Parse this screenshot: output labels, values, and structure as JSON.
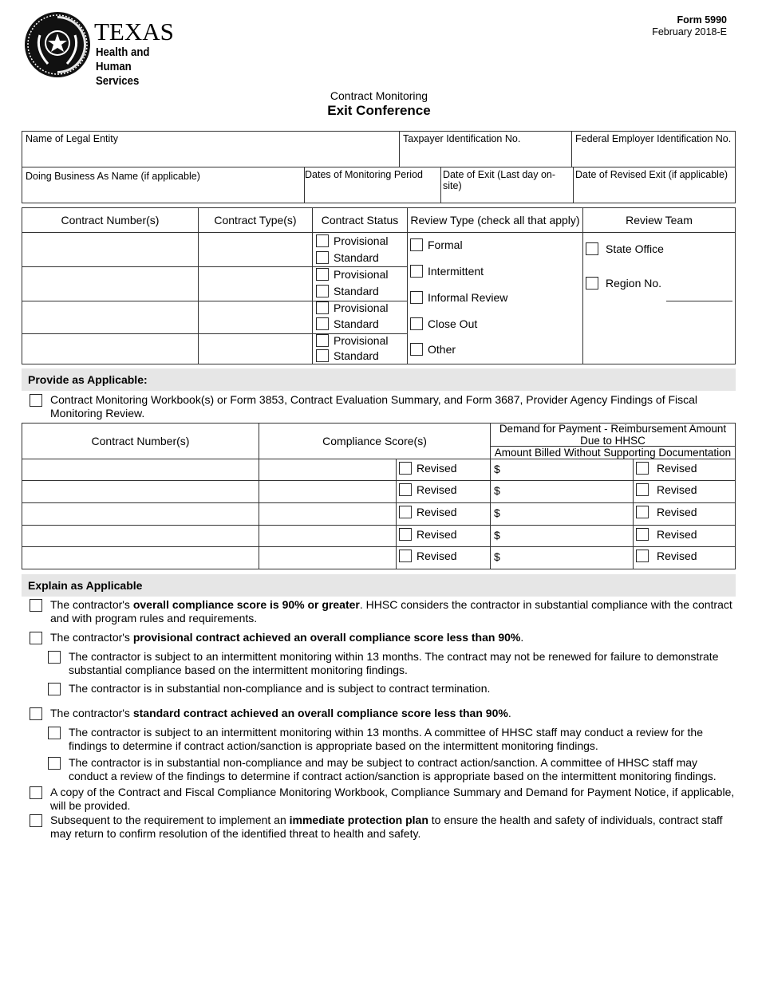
{
  "header": {
    "logo": {
      "icon": "texas-star-seal-icon",
      "line1": "TEXAS",
      "line2": "Health and Human",
      "line3": "Services"
    },
    "form_number": "Form 5990",
    "form_date": "February 2018-E",
    "subtitle": "Contract Monitoring",
    "title": "Exit Conference"
  },
  "entity_info": {
    "legal_entity_label": "Name of Legal Entity",
    "taxpayer_id_label": "Taxpayer Identification No.",
    "fein_label": "Federal Employer Identification No.",
    "dba_label": "Doing Business As Name (if applicable)",
    "monitoring_period_label": "Dates of Monitoring Period",
    "exit_date_label": "Date of Exit (Last day on-site)",
    "revised_exit_label": "Date of Revised Exit (if applicable)"
  },
  "contract_table": {
    "headers": [
      "Contract Number(s)",
      "Contract Type(s)",
      "Contract Status",
      "Review Type (check all that apply)",
      "Review Team"
    ],
    "status_options": [
      "Provisional",
      "Standard"
    ],
    "rows": 4,
    "review_types": [
      "Formal",
      "Intermittent",
      "Informal Review",
      "Close Out",
      "Other"
    ],
    "review_team": [
      "State Office",
      "Region No."
    ]
  },
  "provide": {
    "heading": "Provide as Applicable:",
    "item": "Contract Monitoring Workbook(s) or Form 3853, Contract Evaluation Summary, and Form 3687, Provider Agency Findings of Fiscal Monitoring Review."
  },
  "compliance_table": {
    "headers": {
      "contract_numbers": "Contract Number(s)",
      "compliance_scores": "Compliance Score(s)",
      "demand_payment": "Demand for Payment - Reimbursement Amount Due to HHSC",
      "amount_billed": "Amount Billed Without Supporting Documentation"
    },
    "revised_label": "Revised",
    "currency": "$",
    "rows": 5
  },
  "explain": {
    "heading": "Explain as Applicable",
    "items": [
      {
        "pre": "The contractor's ",
        "bold": "overall compliance score is 90% or greater",
        "post": ". HHSC considers the contractor in substantial compliance with the contract and with program rules and requirements."
      },
      {
        "pre": "The contractor's ",
        "bold": "provisional contract achieved an overall compliance score less than 90%",
        "post": "."
      },
      {
        "pre": "The contractor is subject to an intermittent monitoring within 13 months. The contract may not be renewed for failure to demonstrate substantial compliance based on the intermittent monitoring findings.",
        "bold": "",
        "post": ""
      },
      {
        "pre": "The contractor is in substantial non-compliance and is subject to contract termination.",
        "bold": "",
        "post": ""
      },
      {
        "pre": "The contractor's ",
        "bold": "standard contract achieved an overall compliance score less than 90%",
        "post": "."
      },
      {
        "pre": "The contractor is subject to an intermittent monitoring within 13 months. A committee of HHSC staff may conduct a review for the findings to determine if contract action/sanction is appropriate based on the intermittent monitoring findings.",
        "bold": "",
        "post": ""
      },
      {
        "pre": "The contractor is in substantial non-compliance and may be subject to contract action/sanction. A committee of HHSC staff may conduct a review of the findings to determine if contract action/sanction is appropriate based on the intermittent monitoring findings.",
        "bold": "",
        "post": ""
      },
      {
        "pre": "A copy of the Contract and Fiscal Compliance Monitoring Workbook, Compliance Summary and Demand for Payment Notice, if applicable, will be provided.",
        "bold": "",
        "post": ""
      },
      {
        "pre": "Subsequent to the requirement to implement an ",
        "bold": "immediate protection plan",
        "post": " to ensure the health and safety of individuals, contract staff may return to confirm resolution of the identified threat to health and safety."
      }
    ]
  }
}
